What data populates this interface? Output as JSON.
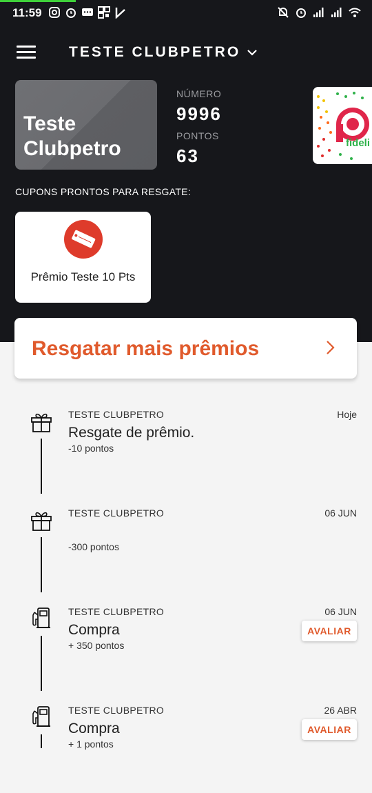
{
  "status_bar": {
    "time": "11:59"
  },
  "header": {
    "title": "TESTE CLUBPETRO"
  },
  "card": {
    "name_line1": "Teste",
    "name_line2": "Clubpetro"
  },
  "info": {
    "numero_label": "NÚMERO",
    "numero_value": "9996",
    "pontos_label": "PONTOS",
    "pontos_value": "63"
  },
  "partner": {
    "brand_text": "fideli"
  },
  "coupons": {
    "label": "CUPONS PRONTOS PARA RESGATE:",
    "items": [
      {
        "name": "Prêmio Teste 10 Pts"
      }
    ]
  },
  "redeem": {
    "label": "Resgatar mais prêmios"
  },
  "timeline": [
    {
      "icon": "gift-icon",
      "store": "TESTE CLUBPETRO",
      "date": "Hoje",
      "description": "Resgate de prêmio.",
      "points": "-10 pontos",
      "action": ""
    },
    {
      "icon": "gift-icon",
      "store": "TESTE CLUBPETRO",
      "date": "06 JUN",
      "description": "",
      "points": "-300 pontos",
      "action": ""
    },
    {
      "icon": "fuel-pump-icon",
      "store": "TESTE CLUBPETRO",
      "date": "06 JUN",
      "description": "Compra",
      "points": "+ 350 pontos",
      "action": "AVALIAR"
    },
    {
      "icon": "fuel-pump-icon",
      "store": "TESTE CLUBPETRO",
      "date": "26 ABR",
      "description": "Compra",
      "points": "+ 1 pontos",
      "action": "AVALIAR"
    }
  ],
  "colors": {
    "dark_bg": "#16171b",
    "accent": "#e05a2c",
    "coupon_red": "#de3b2b",
    "light_bg": "#f4f4f4"
  }
}
